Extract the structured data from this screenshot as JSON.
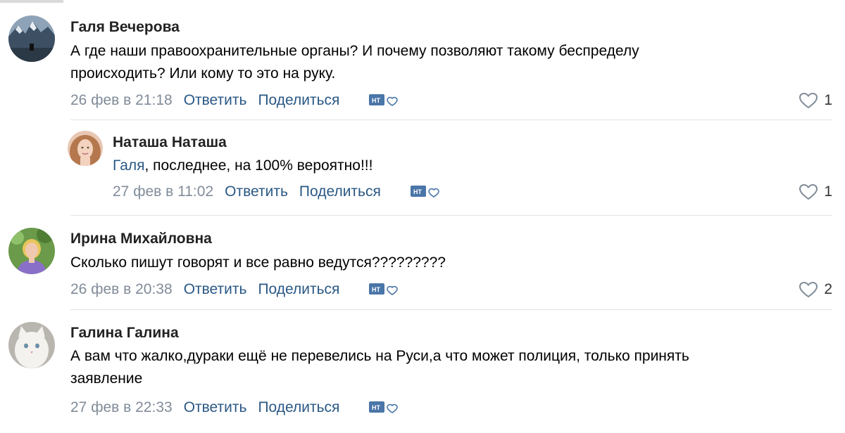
{
  "comments": [
    {
      "author": "Галя Вечерова",
      "text_line1": "А где наши правоохранительные органы? И почему позволяют такому беспределу",
      "text_line2": "происходить? Или кому то это на руку.",
      "date": "26 фев в 21:18",
      "reply": "Ответить",
      "share": "Поделиться",
      "likes": "1"
    },
    {
      "author": "Наташа Наташа",
      "mention": "Галя",
      "text": ", последнее, на 100% вероятно!!!",
      "date": "27 фев в 11:02",
      "reply": "Ответить",
      "share": "Поделиться",
      "likes": "1"
    },
    {
      "author": "Ирина Михайловна",
      "text": "Сколько пишут говорят и все равно ведутся?????????",
      "date": "26 фев в 20:38",
      "reply": "Ответить",
      "share": "Поделиться",
      "likes": "2"
    },
    {
      "author": "Галина Галина",
      "text_line1": "А вам что жалко,дураки ещё не перевелись на Руси,а что может полиция, только принять",
      "text_line2": "заявление",
      "date": "27 фев в 22:33",
      "reply": "Ответить",
      "share": "Поделиться"
    }
  ],
  "colors": {
    "link": "#2a5885",
    "meta": "#818c99",
    "divider": "#e3e4e8"
  },
  "icons": {
    "reaction": "reaction-badge-icon",
    "like": "heart-outline-icon"
  }
}
